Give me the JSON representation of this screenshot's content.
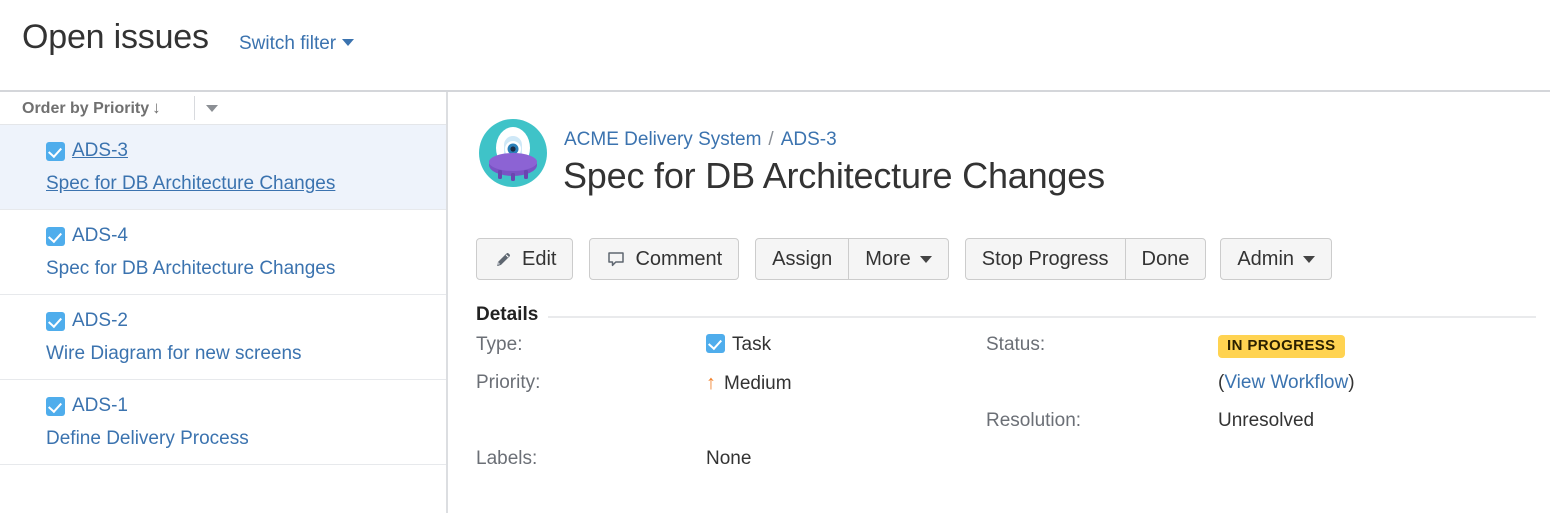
{
  "header": {
    "title": "Open issues",
    "switch_filter_label": "Switch filter",
    "switch_filter_icon": "chevron-down-icon"
  },
  "sidebar": {
    "toolbar": {
      "order_by_label": "Order by Priority",
      "order_direction_icon": "arrow-down-icon",
      "options_icon": "chevron-down-icon"
    },
    "issues": [
      {
        "key": "ADS-3",
        "summary": "Spec for DB Architecture Changes",
        "type_icon": "task-icon",
        "selected": true
      },
      {
        "key": "ADS-4",
        "summary": "Spec for DB Architecture Changes",
        "type_icon": "task-icon",
        "selected": false
      },
      {
        "key": "ADS-2",
        "summary": "Wire Diagram for new screens",
        "type_icon": "task-icon",
        "selected": false
      },
      {
        "key": "ADS-1",
        "summary": "Define Delivery Process",
        "type_icon": "task-icon",
        "selected": false
      }
    ]
  },
  "issue": {
    "avatar_icon": "project-avatar-alien-icon",
    "breadcrumb": {
      "project": "ACME Delivery System",
      "separator": "/",
      "key": "ADS-3"
    },
    "title": "Spec for DB Architecture Changes",
    "toolbar": {
      "edit_label": "Edit",
      "edit_icon": "pencil-icon",
      "comment_label": "Comment",
      "comment_icon": "speech-bubble-icon",
      "assign_label": "Assign",
      "more_label": "More",
      "more_icon": "chevron-down-icon",
      "stop_progress_label": "Stop Progress",
      "done_label": "Done",
      "admin_label": "Admin",
      "admin_icon": "chevron-down-icon"
    },
    "details": {
      "section_title": "Details",
      "type_label": "Type:",
      "type_value": "Task",
      "type_icon": "task-icon",
      "priority_label": "Priority:",
      "priority_value": "Medium",
      "priority_icon": "arrow-up-icon",
      "labels_label": "Labels:",
      "labels_value": "None",
      "status_label": "Status:",
      "status_value": "IN PROGRESS",
      "workflow_open_paren": "(",
      "workflow_link": "View Workflow",
      "workflow_close_paren": ")",
      "resolution_label": "Resolution:",
      "resolution_value": "Unresolved"
    }
  },
  "colors": {
    "link": "#3b73af",
    "task_icon": "#4fadec",
    "status_badge_bg": "#ffd351",
    "priority_arrow": "#f2802a",
    "selected_row_bg": "#eef3fb",
    "avatar_ring": "#3fc3c8",
    "avatar_body": "#7a53c4"
  }
}
